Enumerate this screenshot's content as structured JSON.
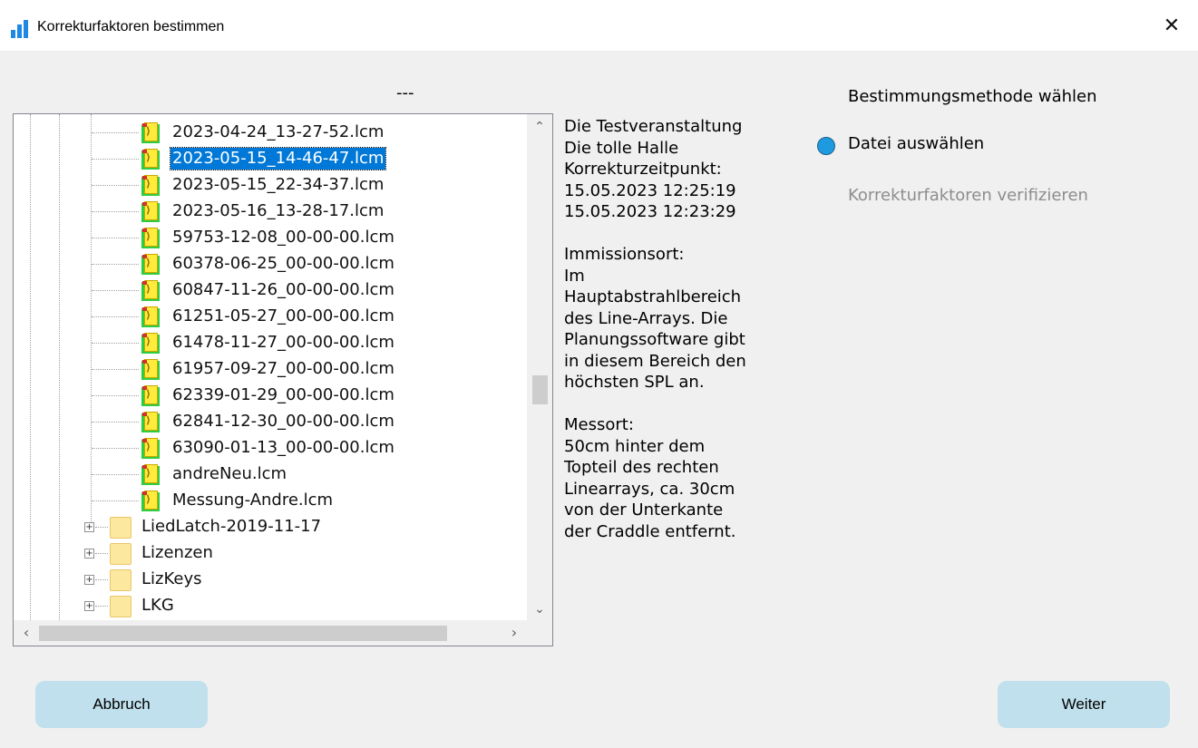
{
  "window": {
    "title": "Korrekturfaktoren bestimmen"
  },
  "tree": {
    "header": "---",
    "files": [
      {
        "label": "2023-04-24_13-27-52.lcm",
        "selected": false
      },
      {
        "label": "2023-05-15_14-46-47.lcm",
        "selected": true
      },
      {
        "label": "2023-05-15_22-34-37.lcm",
        "selected": false
      },
      {
        "label": "2023-05-16_13-28-17.lcm",
        "selected": false
      },
      {
        "label": "59753-12-08_00-00-00.lcm",
        "selected": false
      },
      {
        "label": "60378-06-25_00-00-00.lcm",
        "selected": false
      },
      {
        "label": "60847-11-26_00-00-00.lcm",
        "selected": false
      },
      {
        "label": "61251-05-27_00-00-00.lcm",
        "selected": false
      },
      {
        "label": "61478-11-27_00-00-00.lcm",
        "selected": false
      },
      {
        "label": "61957-09-27_00-00-00.lcm",
        "selected": false
      },
      {
        "label": "62339-01-29_00-00-00.lcm",
        "selected": false
      },
      {
        "label": "62841-12-30_00-00-00.lcm",
        "selected": false
      },
      {
        "label": "63090-01-13_00-00-00.lcm",
        "selected": false
      },
      {
        "label": "andreNeu.lcm",
        "selected": false
      },
      {
        "label": "Messung-Andre.lcm",
        "selected": false
      }
    ],
    "folders": [
      {
        "label": "LiedLatch-2019-11-17"
      },
      {
        "label": "Lizenzen"
      },
      {
        "label": "LizKeys"
      },
      {
        "label": "LKG"
      }
    ],
    "vscroll_position": 0.55,
    "hscroll_position": 0.0
  },
  "description": {
    "paragraphs": [
      [
        "Die Testveranstaltung",
        "Die tolle Halle",
        "Korrekturzeitpunkt:",
        "15.05.2023 12:25:19",
        "15.05.2023 12:23:29"
      ],
      [
        "Immissionsort:",
        "Im",
        "Hauptabstrahlbereich",
        "des Line-Arrays. Die",
        "Planungssoftware gibt",
        "in diesem Bereich den",
        "höchsten SPL an."
      ],
      [
        "Messort:",
        "50cm hinter dem",
        "Topteil des rechten",
        "Linearrays, ca. 30cm",
        "von der Unterkante",
        "der Craddle entfernt."
      ]
    ]
  },
  "method": {
    "title": "Bestimmungsmethode wählen",
    "option_select_file": "Datei auswählen",
    "option_verify": "Korrekturfaktoren verifizieren"
  },
  "buttons": {
    "cancel": "Abbruch",
    "next": "Weiter"
  },
  "colors": {
    "accent": "#0078d7",
    "button_bg": "#bfe0ec",
    "radio": "#1e9be0"
  },
  "icons": {
    "app": "chart-bars-icon",
    "close": "close-icon",
    "file": "lcm-file-icon",
    "folder": "folder-icon",
    "expand": "plus-box-icon"
  }
}
